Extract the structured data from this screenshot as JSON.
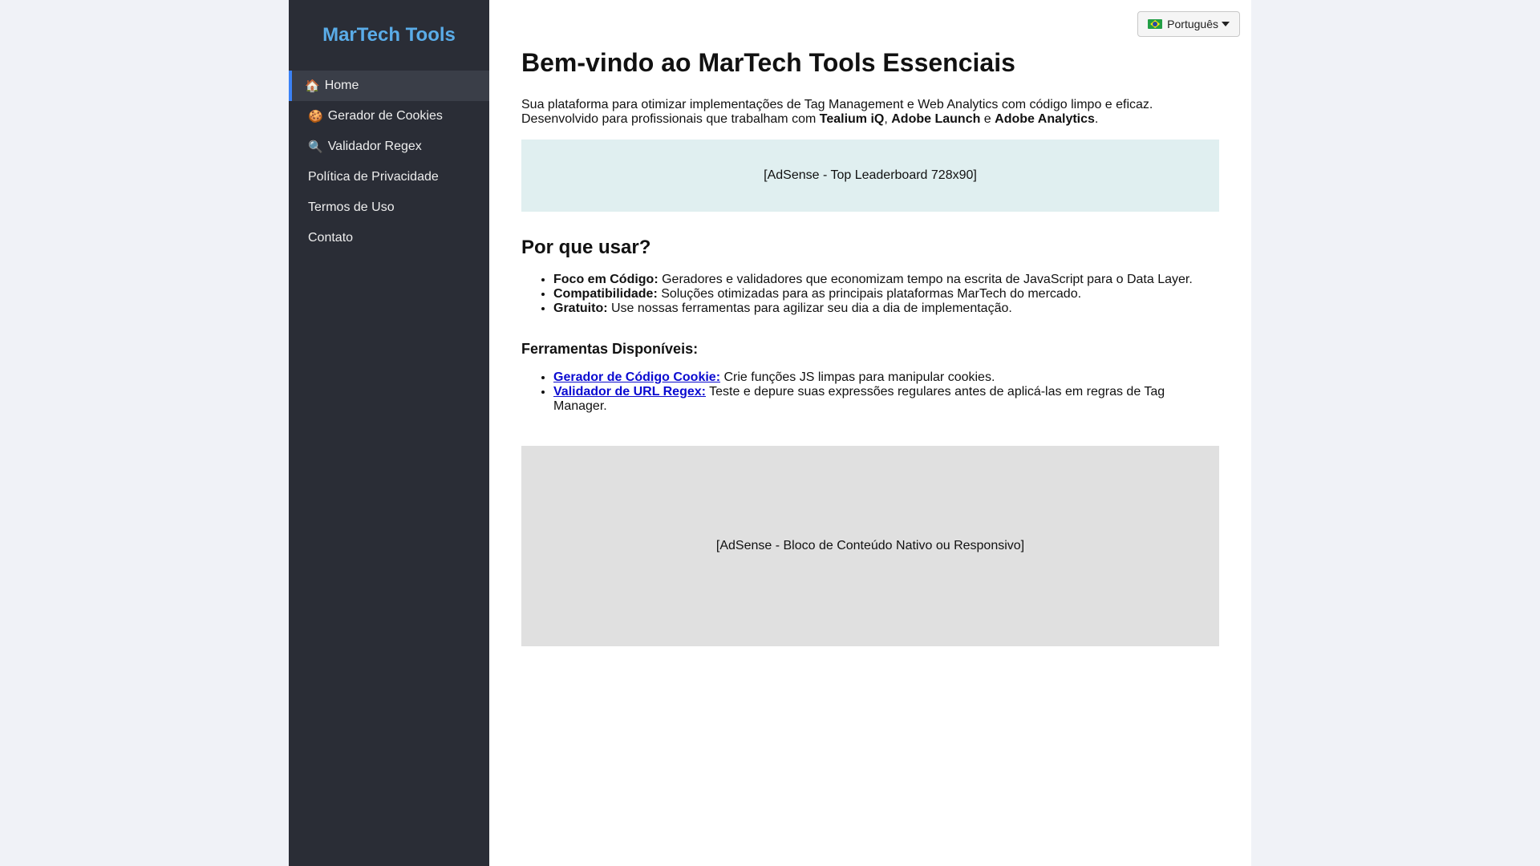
{
  "sidebar": {
    "brand": "MarTech Tools",
    "items": [
      {
        "icon": "🏠",
        "label": "Home"
      },
      {
        "icon": "🍪",
        "label": "Gerador de Cookies"
      },
      {
        "icon": "🔍",
        "label": "Validador Regex"
      },
      {
        "label": "Política de Privacidade"
      },
      {
        "label": "Termos de Uso"
      },
      {
        "label": "Contato"
      }
    ]
  },
  "header": {
    "language": "Português"
  },
  "main": {
    "title": "Bem-vindo ao MarTech Tools Essenciais",
    "intro_line1": "Sua plataforma para otimizar implementações de Tag Management e Web Analytics com código limpo e eficaz.",
    "intro_line2_prefix": "Desenvolvido para profissionais que trabalham com ",
    "platform1": "Tealium iQ",
    "sep1": ", ",
    "platform2": "Adobe Launch",
    "sep2": " e ",
    "platform3": "Adobe Analytics",
    "end": ".",
    "ad_top": "[AdSense - Top Leaderboard 728x90]",
    "why_title": "Por que usar?",
    "why_items": [
      {
        "label": "Foco em Código:",
        "text": " Geradores e validadores que economizam tempo na escrita de JavaScript para o Data Layer."
      },
      {
        "label": "Compatibilidade:",
        "text": " Soluções otimizadas para as principais plataformas MarTech do mercado."
      },
      {
        "label": "Gratuito:",
        "text": " Use nossas ferramentas para agilizar seu dia a dia de implementação."
      }
    ],
    "tools_title": "Ferramentas Disponíveis:",
    "tools": [
      {
        "link": "Gerador de Código Cookie:",
        "text": " Crie funções JS limpas para manipular cookies."
      },
      {
        "link": "Validador de URL Regex:",
        "text": " Teste e depure suas expressões regulares antes de aplicá-las em regras de Tag Manager."
      }
    ],
    "ad_block": "[AdSense - Bloco de Conteúdo Nativo ou Responsivo]"
  }
}
